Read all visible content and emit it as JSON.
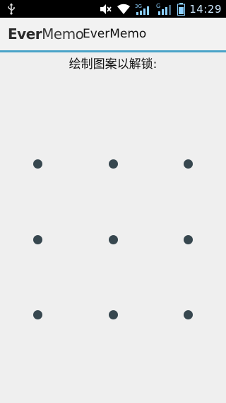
{
  "status_bar": {
    "time": "14:29",
    "icons": [
      "usb-icon",
      "mute-icon",
      "wifi-icon",
      "signal-3g-icon",
      "signal-g-icon",
      "battery-icon"
    ],
    "network_label_1": "3G",
    "network_label_2": "G"
  },
  "action_bar": {
    "logo_bold": "Ever",
    "logo_light": "Memo",
    "title": "EverMemo",
    "accent_color": "#4aa3c8"
  },
  "lock_screen": {
    "prompt": "绘制图案以解锁:",
    "dot_color": "#37474f",
    "dots": [
      {
        "row": 1,
        "col": 1
      },
      {
        "row": 1,
        "col": 2
      },
      {
        "row": 1,
        "col": 3
      },
      {
        "row": 2,
        "col": 1
      },
      {
        "row": 2,
        "col": 2
      },
      {
        "row": 2,
        "col": 3
      },
      {
        "row": 3,
        "col": 1
      },
      {
        "row": 3,
        "col": 2
      },
      {
        "row": 3,
        "col": 3
      }
    ]
  }
}
